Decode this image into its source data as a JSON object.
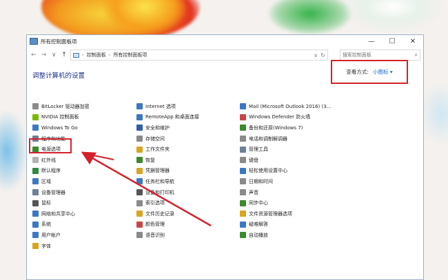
{
  "window": {
    "title": "所有控制面板项",
    "controls": {
      "minimize": "—",
      "maximize": "☐",
      "close": "✕"
    }
  },
  "nav": {
    "back": "←",
    "forward": "→",
    "recent": "∨",
    "up": "↑"
  },
  "address": {
    "crumbs": [
      "控制面板",
      "所有控制面板项"
    ],
    "separator": "›"
  },
  "search": {
    "placeholder": "搜索控制面板"
  },
  "heading": "调整计算机的设置",
  "view_by": {
    "label": "查看方式:",
    "value": "小图标 ▾"
  },
  "columns": [
    [
      {
        "label": "BitLocker 驱动器加密",
        "icon": "bitlocker-icon",
        "color": "#8a8a8a"
      },
      {
        "label": "NVIDIA 控制面板",
        "icon": "nvidia-icon",
        "color": "#76b900"
      },
      {
        "label": "Windows To Go",
        "icon": "windows-to-go-icon",
        "color": "#3b78c4"
      },
      {
        "label": "程序和功能",
        "icon": "programs-icon",
        "color": "#6e7f96"
      },
      {
        "label": "电源选项",
        "icon": "power-icon",
        "color": "#3c8a2e"
      },
      {
        "label": "红外线",
        "icon": "infrared-icon",
        "color": "#b3b3b3"
      },
      {
        "label": "默认程序",
        "icon": "default-programs-icon",
        "color": "#2d8a3e"
      },
      {
        "label": "区域",
        "icon": "region-icon",
        "color": "#3b78c4"
      },
      {
        "label": "设备管理器",
        "icon": "device-manager-icon",
        "color": "#6e7f96"
      },
      {
        "label": "鼠标",
        "icon": "mouse-icon",
        "color": "#555555"
      },
      {
        "label": "网络和共享中心",
        "icon": "network-icon",
        "color": "#3b78c4"
      },
      {
        "label": "系统",
        "icon": "system-icon",
        "color": "#3b78c4"
      },
      {
        "label": "用户帐户",
        "icon": "user-accounts-icon",
        "color": "#3b78c4"
      },
      {
        "label": "字体",
        "icon": "fonts-icon",
        "color": "#d9a521"
      }
    ],
    [
      {
        "label": "Internet 选项",
        "icon": "internet-options-icon",
        "color": "#3b78c4"
      },
      {
        "label": "RemoteApp 和桌面连接",
        "icon": "remoteapp-icon",
        "color": "#3b78c4"
      },
      {
        "label": "安全和维护",
        "icon": "security-maintenance-icon",
        "color": "#2f5fa8"
      },
      {
        "label": "存储空间",
        "icon": "storage-spaces-icon",
        "color": "#8a8a8a"
      },
      {
        "label": "工作文件夹",
        "icon": "work-folders-icon",
        "color": "#d9a521"
      },
      {
        "label": "恢复",
        "icon": "recovery-icon",
        "color": "#3c8a2e"
      },
      {
        "label": "凭据管理器",
        "icon": "credential-manager-icon",
        "color": "#d9a521"
      },
      {
        "label": "任务栏和导航",
        "icon": "taskbar-icon",
        "color": "#3b78c4"
      },
      {
        "label": "设备和打印机",
        "icon": "devices-printers-icon",
        "color": "#555555"
      },
      {
        "label": "索引选项",
        "icon": "indexing-icon",
        "color": "#8a8a8a"
      },
      {
        "label": "文件历史记录",
        "icon": "file-history-icon",
        "color": "#d9a521"
      },
      {
        "label": "颜色管理",
        "icon": "color-management-icon",
        "color": "#c94545"
      },
      {
        "label": "语音识别",
        "icon": "speech-icon",
        "color": "#8a8a8a"
      }
    ],
    [
      {
        "label": "Mail (Microsoft Outlook 2016) (3...",
        "icon": "mail-icon",
        "color": "#3b78c4"
      },
      {
        "label": "Windows Defender 防火墙",
        "icon": "firewall-icon",
        "color": "#c94545"
      },
      {
        "label": "备份和还原(Windows 7)",
        "icon": "backup-icon",
        "color": "#3c8a2e"
      },
      {
        "label": "电话和调制解调器",
        "icon": "phone-modem-icon",
        "color": "#8a8a8a"
      },
      {
        "label": "管理工具",
        "icon": "admin-tools-icon",
        "color": "#6e7f96"
      },
      {
        "label": "键盘",
        "icon": "keyboard-icon",
        "color": "#8a8a8a"
      },
      {
        "label": "轻松使用设置中心",
        "icon": "ease-of-access-icon",
        "color": "#3b78c4"
      },
      {
        "label": "日期和时间",
        "icon": "date-time-icon",
        "color": "#8a8a8a"
      },
      {
        "label": "声音",
        "icon": "sound-icon",
        "color": "#8a8a8a"
      },
      {
        "label": "同步中心",
        "icon": "sync-center-icon",
        "color": "#3c8a2e"
      },
      {
        "label": "文件资源管理器选项",
        "icon": "explorer-options-icon",
        "color": "#d9a521"
      },
      {
        "label": "疑难解答",
        "icon": "troubleshooting-icon",
        "color": "#3b78c4"
      },
      {
        "label": "自动播放",
        "icon": "autoplay-icon",
        "color": "#3c8a2e"
      }
    ]
  ]
}
